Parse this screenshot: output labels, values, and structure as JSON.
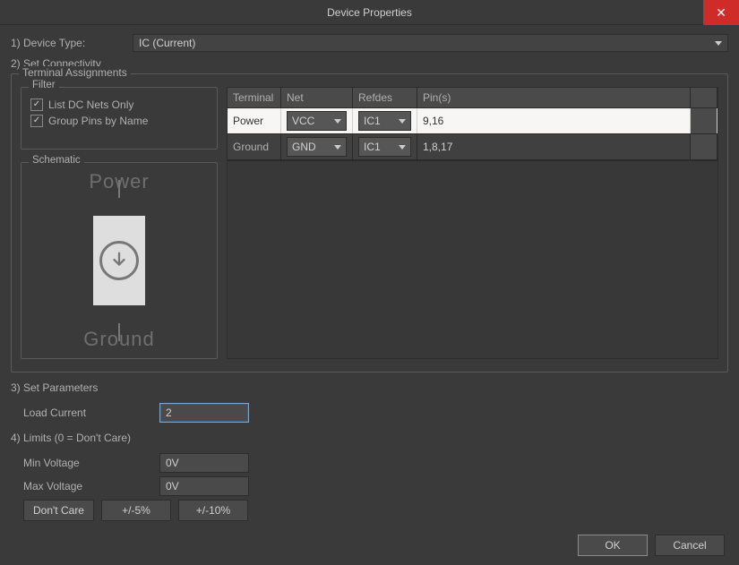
{
  "window": {
    "title": "Device Properties",
    "close_label": "✕"
  },
  "step1": {
    "label": "1) Device Type:",
    "dropdown": {
      "value": "IC (Current)"
    }
  },
  "step2": {
    "label": "2) Set Connectivity"
  },
  "terminal_assignments": {
    "legend": "Terminal Assignments",
    "filter": {
      "legend": "Filter",
      "list_dc_label": "List DC Nets Only",
      "group_pins_label": "Group Pins by Name",
      "list_dc_checked": true,
      "group_pins_checked": true
    },
    "schematic": {
      "legend": "Schematic",
      "top": "Power",
      "bottom": "Ground"
    },
    "table": {
      "headers": {
        "c0": "Terminal",
        "c1": "Net",
        "c2": "Refdes",
        "c3": "Pin(s)"
      },
      "rows": [
        {
          "terminal": "Power",
          "net": "VCC",
          "refdes": "IC1",
          "pins": "9,16"
        },
        {
          "terminal": "Ground",
          "net": "GND",
          "refdes": "IC1",
          "pins": "1,8,17"
        }
      ]
    }
  },
  "step3": {
    "label": "3) Set Parameters",
    "load_current": {
      "label": "Load Current",
      "value": "2"
    }
  },
  "step4": {
    "label": "4) Limits (0 = Don't Care)",
    "min_voltage": {
      "label": "Min Voltage",
      "value": "0V"
    },
    "max_voltage": {
      "label": "Max Voltage",
      "value": "0V"
    },
    "buttons": {
      "dontcare": "Don't Care",
      "pm5": "+/-5%",
      "pm10": "+/-10%"
    }
  },
  "footer": {
    "ok": "OK",
    "cancel": "Cancel"
  }
}
